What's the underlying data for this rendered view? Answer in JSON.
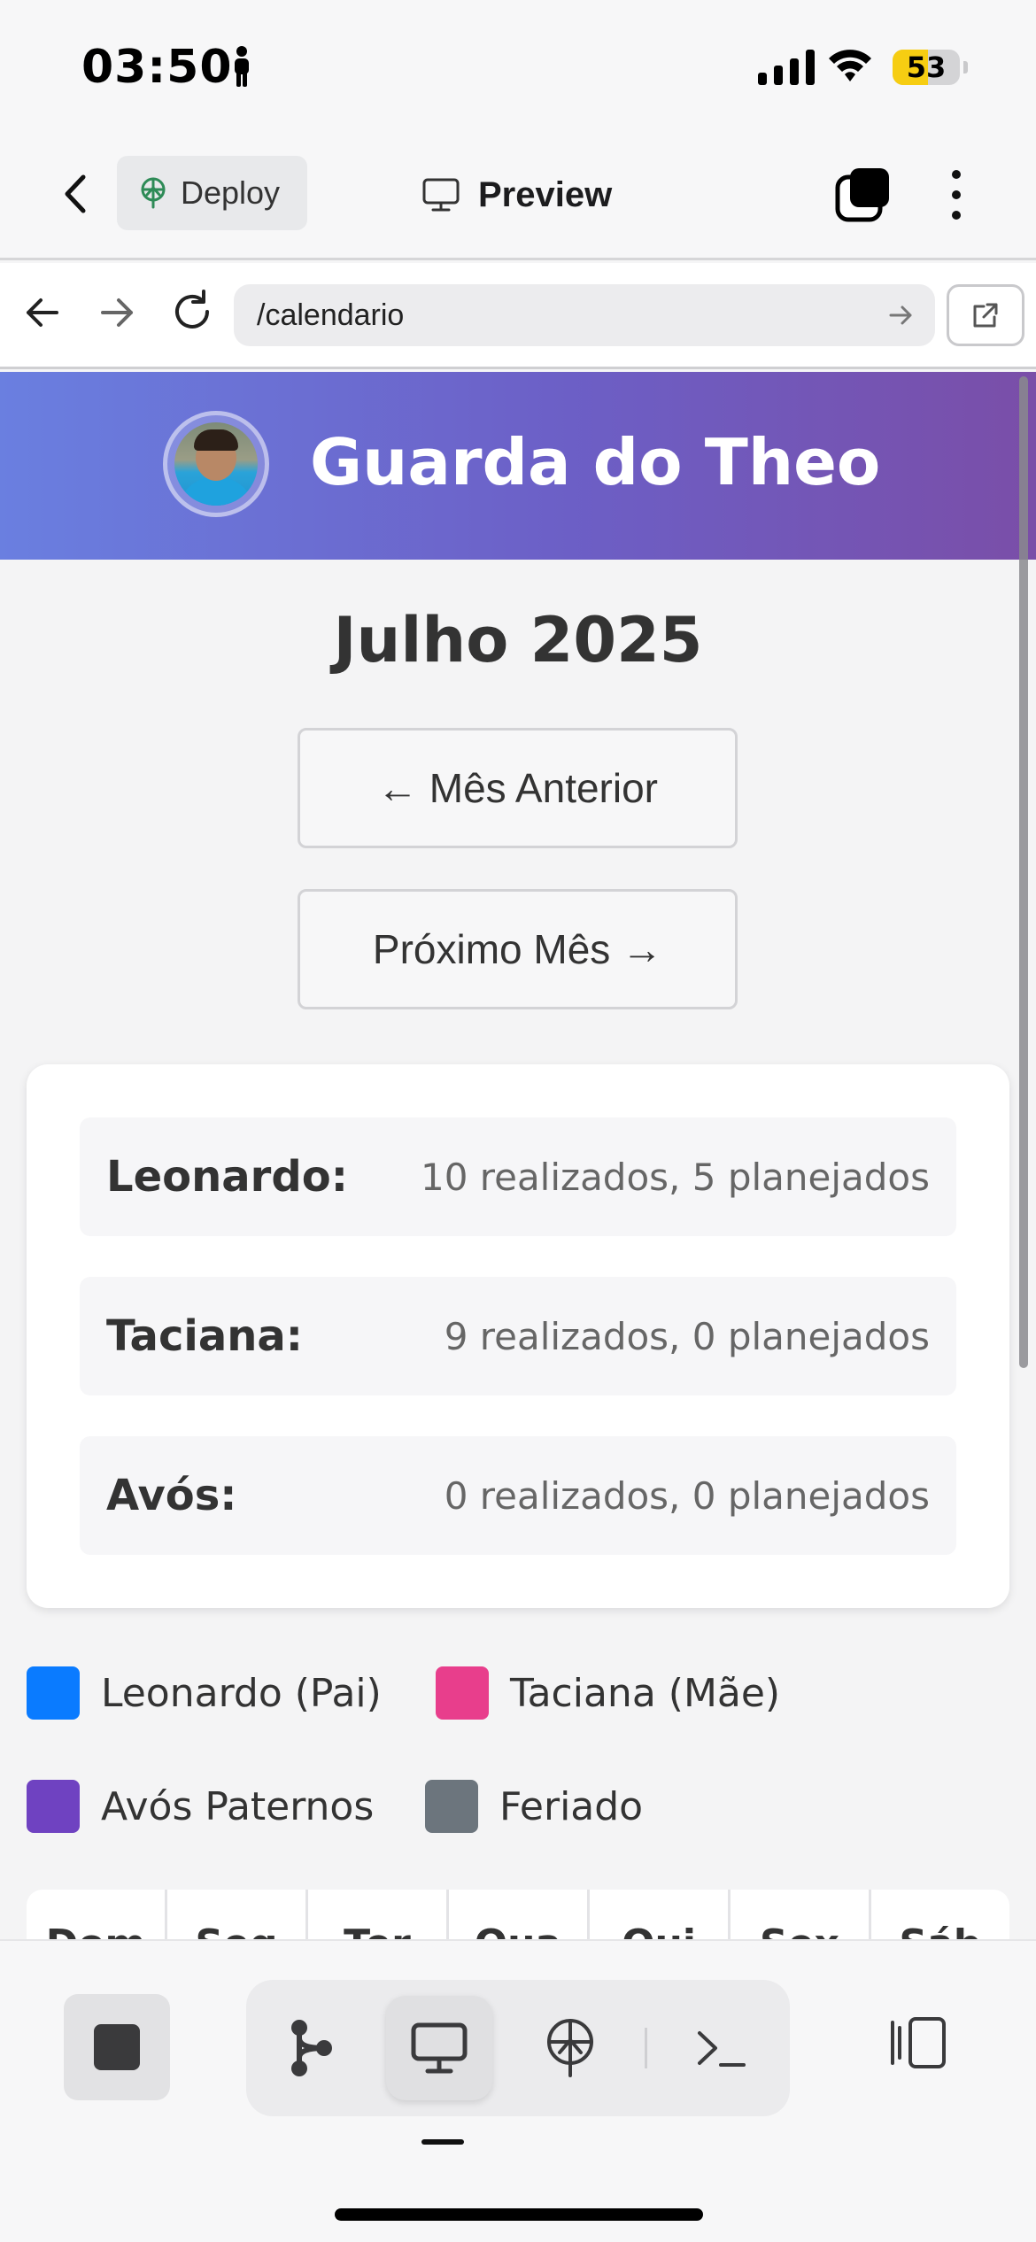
{
  "status_bar": {
    "time": "03:50",
    "battery_percent": 53,
    "battery_label": "53",
    "battery_color": "#f6cd12"
  },
  "toolbar": {
    "back_icon": "chevron-left-icon",
    "deploy_label": "Deploy",
    "deploy_icon": "deploy-icon",
    "preview_label": "Preview",
    "preview_icon": "monitor-icon",
    "tabs_icon": "tabs-icon",
    "more_icon": "more-vertical-icon"
  },
  "browser": {
    "url": "/calendario",
    "back_icon": "arrow-left-icon",
    "forward_icon": "arrow-right-icon",
    "reload_icon": "reload-icon",
    "open_external_icon": "external-link-icon"
  },
  "app": {
    "title": "Guarda do Theo",
    "month": "Julho 2025",
    "prev_button": "← Mês Anterior",
    "next_button": "Próximo Mês →",
    "header_gradient": [
      "#6a7fe0",
      "#7a4ea8"
    ],
    "summary": [
      {
        "name": "Leonardo:",
        "stats": "10 realizados, 5 planejados"
      },
      {
        "name": "Taciana:",
        "stats": "9 realizados, 0 planejados"
      },
      {
        "name": "Avós:",
        "stats": "0 realizados, 0 planejados"
      }
    ],
    "legend": [
      {
        "label": "Leonardo (Pai)",
        "color": "#0a7bff"
      },
      {
        "label": "Taciana (Mãe)",
        "color": "#e83e8c"
      },
      {
        "label": "Avós Paternos",
        "color": "#6f42c1"
      },
      {
        "label": "Feriado",
        "color": "#6c757d"
      }
    ],
    "weekdays": [
      "Dom",
      "Seg",
      "Ter",
      "Qua",
      "Qui",
      "Sex",
      "Sáb"
    ]
  },
  "bottom_bar": {
    "stop_icon": "stop-icon",
    "items": [
      {
        "name": "git-branch-icon",
        "active": false
      },
      {
        "name": "monitor-icon",
        "active": true
      },
      {
        "name": "deploy-icon",
        "active": false
      },
      {
        "name": "terminal-icon",
        "active": false
      }
    ],
    "split_icon": "split-view-icon"
  }
}
